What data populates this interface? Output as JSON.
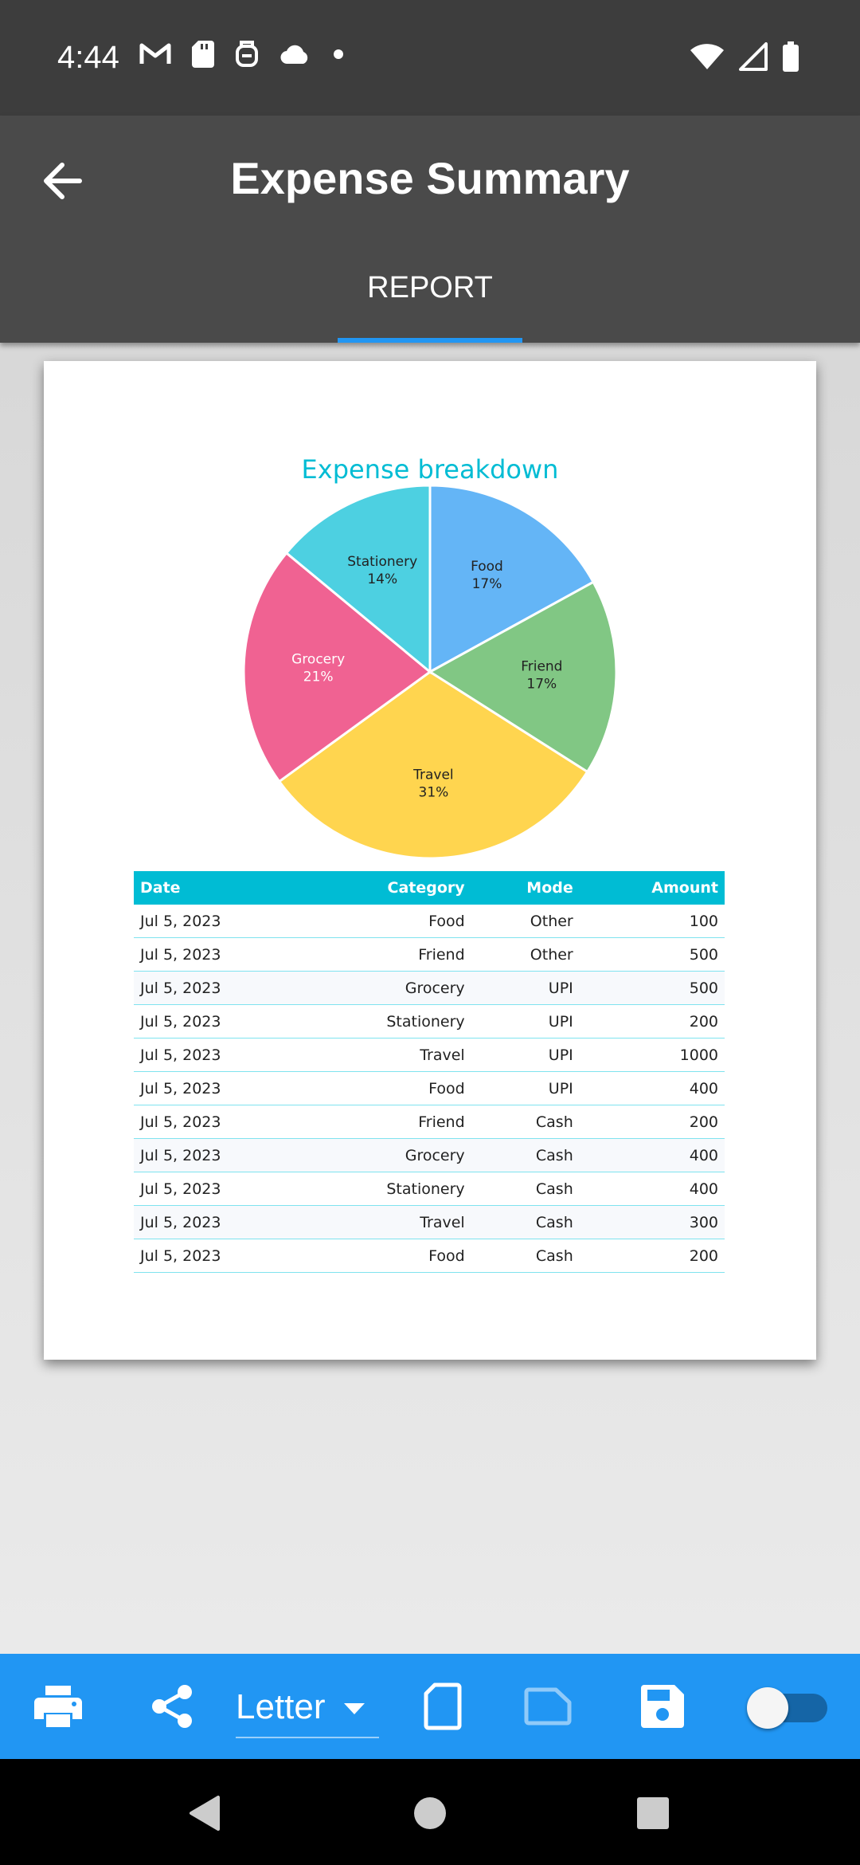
{
  "status_bar": {
    "time": "4:44",
    "left_icons": [
      "gmail-icon",
      "sd-card-icon",
      "assistant-icon",
      "cloud-icon",
      "dot-icon"
    ],
    "right_icons": [
      "wifi-icon",
      "signal-icon",
      "battery-icon"
    ]
  },
  "app_bar": {
    "title": "Expense Summary",
    "back_icon": "arrow-back-icon",
    "tabs": [
      {
        "label": "REPORT",
        "selected": true
      }
    ],
    "accent": "#2196f3"
  },
  "report": {
    "chart_data": {
      "type": "pie",
      "title": "Expense breakdown",
      "slices": [
        {
          "label": "Food",
          "value": 17,
          "pct_text": "17%",
          "color": "#64b5f6",
          "text_color": "#222222"
        },
        {
          "label": "Friend",
          "value": 17,
          "pct_text": "17%",
          "color": "#81c784",
          "text_color": "#222222"
        },
        {
          "label": "Travel",
          "value": 31,
          "pct_text": "31%",
          "color": "#ffd54f",
          "text_color": "#222222"
        },
        {
          "label": "Grocery",
          "value": 21,
          "pct_text": "21%",
          "color": "#f06292",
          "text_color": "#ffffff"
        },
        {
          "label": "Stationery",
          "value": 14,
          "pct_text": "14%",
          "color": "#4dd0e1",
          "text_color": "#222222"
        }
      ],
      "title_color": "#00bcd4"
    },
    "table": {
      "headers": [
        "Date",
        "Category",
        "Mode",
        "Amount"
      ],
      "rows": [
        [
          "Jul 5, 2023",
          "Food",
          "Other",
          "100"
        ],
        [
          "Jul 5, 2023",
          "Friend",
          "Other",
          "500"
        ],
        [
          "Jul 5, 2023",
          "Grocery",
          "UPI",
          "500"
        ],
        [
          "Jul 5, 2023",
          "Stationery",
          "UPI",
          "200"
        ],
        [
          "Jul 5, 2023",
          "Travel",
          "UPI",
          "1000"
        ],
        [
          "Jul 5, 2023",
          "Food",
          "UPI",
          "400"
        ],
        [
          "Jul 5, 2023",
          "Friend",
          "Cash",
          "200"
        ],
        [
          "Jul 5, 2023",
          "Grocery",
          "Cash",
          "400"
        ],
        [
          "Jul 5, 2023",
          "Stationery",
          "Cash",
          "400"
        ],
        [
          "Jul 5, 2023",
          "Travel",
          "Cash",
          "300"
        ],
        [
          "Jul 5, 2023",
          "Food",
          "Cash",
          "200"
        ]
      ],
      "header_color": "#00bcd4"
    }
  },
  "toolbar": {
    "paper_size": "Letter",
    "icons": [
      "print-icon",
      "share-icon",
      "portrait-orientation-icon",
      "landscape-orientation-icon",
      "save-icon"
    ],
    "toggle_on": false,
    "color": "#2196f3"
  },
  "nav_bar": {
    "icons": [
      "back-triangle-icon",
      "home-circle-icon",
      "recents-square-icon"
    ]
  }
}
